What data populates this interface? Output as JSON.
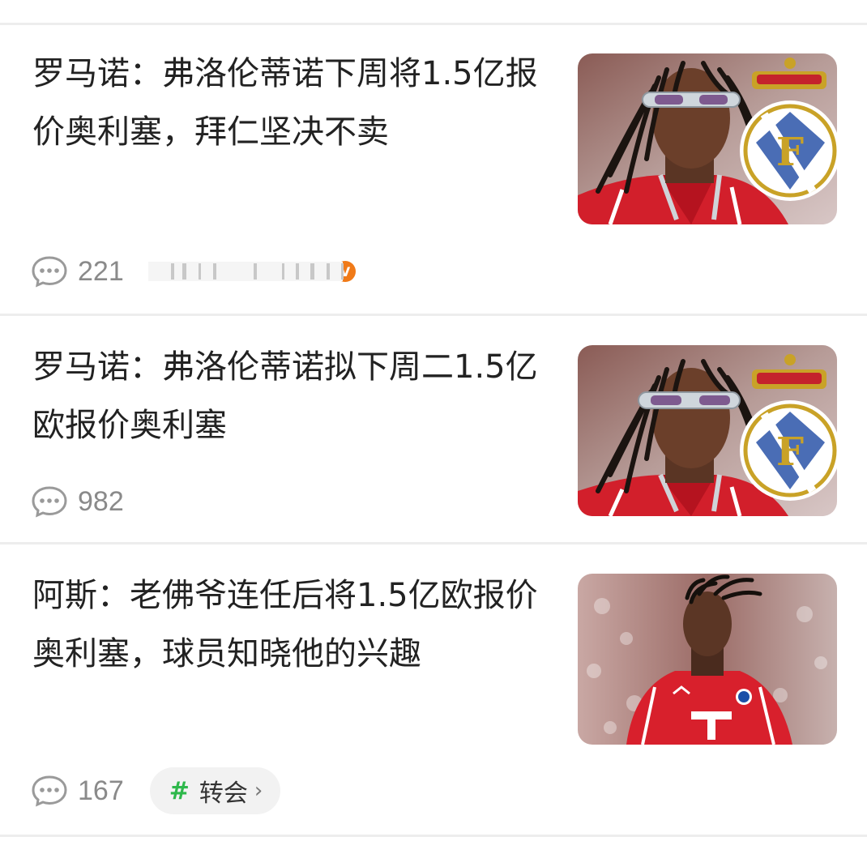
{
  "feed": {
    "items": [
      {
        "title": "罗马诺：弗洛伦蒂诺下周将1.5亿报价奥利塞，拜仁坚决不卖",
        "comment_count": "221",
        "thumbnail": "player-goggles-real-madrid-crest",
        "has_author_badge": true,
        "badge_letter": "V"
      },
      {
        "title": "罗马诺：弗洛伦蒂诺拟下周二1.5亿欧报价奥利塞",
        "comment_count": "982",
        "thumbnail": "player-goggles-real-madrid-crest"
      },
      {
        "title": "阿斯：老佛爷连任后将1.5亿欧报价奥利塞，球员知晓他的兴趣",
        "comment_count": "167",
        "thumbnail": "player-bayern-red-kit",
        "tag": {
          "symbol": "#",
          "label": "转会",
          "chevron": "›"
        }
      }
    ]
  },
  "icons": {
    "comment": "comment-bubble-icon",
    "verified": "verified-badge-icon"
  },
  "colors": {
    "tag_hash": "#2eb84b",
    "badge": "#f07a18",
    "meta_text": "#8a8a8a",
    "title_text": "#222222",
    "divider": "#ededed"
  }
}
